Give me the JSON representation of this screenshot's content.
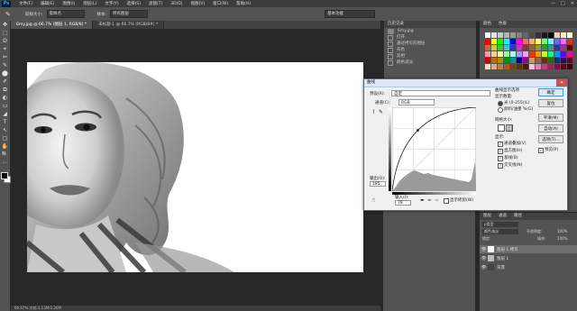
{
  "app": {
    "logo": "Ps"
  },
  "menu": [
    "文件(F)",
    "编辑(E)",
    "图像(I)",
    "图层(L)",
    "文字(Y)",
    "选择(S)",
    "滤镜(T)",
    "3D(D)",
    "视图(V)",
    "窗口(W)",
    "帮助(H)"
  ],
  "window_controls": {
    "minimize": "—",
    "maximize": "□",
    "close": "✕"
  },
  "options_bar": {
    "tool_icon": "eyedropper-icon",
    "sample_size_label": "取样大小:",
    "sample_size_value": "取样点",
    "sample_label": "样本:",
    "sample_value": "所有图层",
    "workspace_value": "基本功能"
  },
  "tools": [
    "✥",
    "⬚",
    "ʘ",
    "⌖",
    "✂",
    "✎",
    "⬤",
    "✐",
    "⧉",
    "◐",
    "▭",
    "◢",
    "T",
    "↖",
    "▢",
    "✋",
    "🔍",
    "⋯"
  ],
  "document": {
    "tabs": [
      {
        "label": "6my.jpg @ 66.7% (图层 1, RGB/8) *",
        "active": true
      },
      {
        "label": "未标题-1 @ 66.7% (RGB/8#) *",
        "active": false
      }
    ],
    "status": "66.67%   文档:1.13M/2.26M"
  },
  "history_panel": {
    "tabs": [
      "历史记录",
      "动作"
    ],
    "snapshot": "6my.jpg",
    "items": [
      "打开",
      "通过拷贝的图层",
      "去色",
      "反相",
      "颜色减淡"
    ]
  },
  "swatches_panel": {
    "tabs": [
      "颜色",
      "色板"
    ],
    "colors": [
      "#ffffff",
      "#e6e6e6",
      "#cccccc",
      "#b3b3b3",
      "#999999",
      "#808080",
      "#666666",
      "#4d4d4d",
      "#333333",
      "#1a1a1a",
      "#000000",
      "#ffcccc",
      "#ffeecc",
      "#ffffcc",
      "#ff0000",
      "#ffff00",
      "#00ff00",
      "#00ffff",
      "#0000ff",
      "#ff00ff",
      "#ff6666",
      "#ffaa66",
      "#ffff66",
      "#66ff66",
      "#66ffff",
      "#6666ff",
      "#ff66ff",
      "#cc3333",
      "#cc6633",
      "#cccc33",
      "#33cc33",
      "#33cccc",
      "#3333cc",
      "#cc33cc",
      "#993333",
      "#996633",
      "#999933",
      "#339933",
      "#339999",
      "#333399",
      "#993399",
      "#660000",
      "#ff9999",
      "#ffcc99",
      "#ffff99",
      "#99ff99",
      "#99ffff",
      "#9999ff",
      "#ff99ff",
      "#ff3300",
      "#ff9900",
      "#ccff00",
      "#00ff99",
      "#0099ff",
      "#6600ff",
      "#ff0099",
      "#cc0000",
      "#cc6600",
      "#999900",
      "#009900",
      "#009999",
      "#000099",
      "#990099",
      "#cc9966",
      "#996633",
      "#663300",
      "#336600",
      "#003366",
      "#330066",
      "#660033",
      "#ffe0c0",
      "#e0b080",
      "#c08040",
      "#a06020",
      "#804010",
      "#603000",
      "#402000",
      "#ffc0e0",
      "#e080c0",
      "#c04080",
      "#a02060",
      "#801040",
      "#600020",
      "#400010"
    ]
  },
  "layers_panel": {
    "tabs": [
      "图层",
      "通道",
      "路径"
    ],
    "filter_label": "ρ类型",
    "blend_mode": "颜色减淡",
    "opacity_label": "不透明度:",
    "opacity_value": "100%",
    "fill_label": "填充:",
    "fill_value": "100%",
    "lock_label": "锁定:",
    "layers": [
      {
        "name": "图层 1 拷贝",
        "selected": true
      },
      {
        "name": "图层 1",
        "selected": false
      },
      {
        "name": "背景",
        "selected": false
      }
    ]
  },
  "curves_dialog": {
    "title": "曲线",
    "close_glyph": "✕",
    "preset_label": "预设(R):",
    "preset_value": "自定",
    "channel_label": "通道(C):",
    "channel_value": "RGB",
    "output_label": "输出(O):",
    "output_value": "185",
    "input_label": "输入(I):",
    "input_value": "78",
    "show_clipping_label": "显示修剪(W)",
    "curve_display_title": "曲线显示选项",
    "show_amount_label": "显示数量:",
    "light_label": "光 (0-255)(L)",
    "pigment_label": "颜料/油墨 %(G)",
    "grid_size_label": "网格大小:",
    "show_label": "显示:",
    "options": [
      {
        "label": "通道叠加(V)",
        "checked": true
      },
      {
        "label": "直方图(H)",
        "checked": true
      },
      {
        "label": "基线(B)",
        "checked": true
      },
      {
        "label": "交叉线(N)",
        "checked": true
      }
    ],
    "buttons": {
      "ok": "确定",
      "reset": "复位",
      "smooth": "平滑(M)",
      "auto": "自动(A)",
      "options": "选项(T)..."
    },
    "preview_label": "预览(P)",
    "preview_checked": true
  }
}
